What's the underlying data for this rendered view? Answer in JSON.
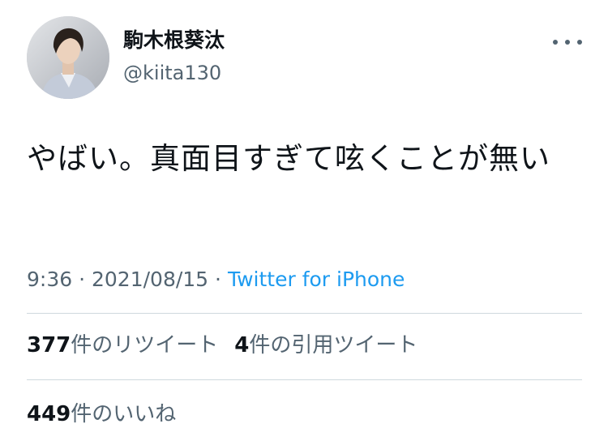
{
  "tweet": {
    "author": {
      "display_name": "駒木根葵汰",
      "handle": "@kiita130"
    },
    "more_icon": "more-horizontal-icon",
    "text": "やばい。真面目すぎて呟くことが無い",
    "time": "9:36",
    "date": "2021/08/15",
    "separator": "·",
    "source": "Twitter for iPhone"
  },
  "stats": {
    "retweets": {
      "count": "377",
      "label": "件のリツイート"
    },
    "quotes": {
      "count": "4",
      "label": "件の引用ツイート"
    },
    "likes": {
      "count": "449",
      "label": "件のいいね"
    }
  },
  "colors": {
    "text": "#0f1419",
    "secondary": "#536471",
    "link": "#1d9bf0",
    "divider": "#cfd9de"
  }
}
